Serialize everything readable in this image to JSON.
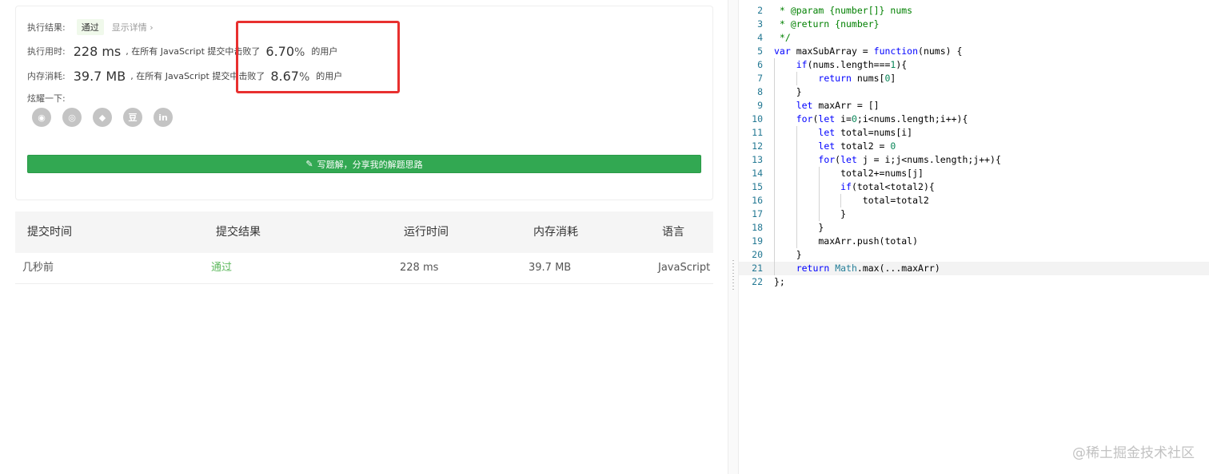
{
  "result": {
    "status_label": "执行结果:",
    "status_value": "通过",
    "detail_link": "显示详情 ›",
    "runtime_label": "执行用时:",
    "runtime_value": "228 ms",
    "runtime_desc": ", 在所有 JavaScript 提交中击败了",
    "runtime_pct": "6.70",
    "runtime_suffix": "的用户",
    "memory_label": "内存消耗:",
    "memory_value": "39.7 MB",
    "memory_desc": ", 在所有 JavaScript 提交中击败了",
    "memory_pct": "8.67",
    "memory_suffix": "的用户",
    "pct_symbol": "%",
    "share_label": "炫耀一下:",
    "share_icons": [
      "wechat-icon",
      "weibo-icon",
      "qq-icon",
      "douban-icon",
      "linkedin-icon"
    ],
    "share_glyphs": [
      "◉",
      "◎",
      "◆",
      "豆",
      "in"
    ],
    "write_button": "写题解，分享我的解题思路",
    "accent_color": "#32a852",
    "highlight_color": "#e8302f"
  },
  "submissions": {
    "headers": [
      "提交时间",
      "提交结果",
      "运行时间",
      "内存消耗",
      "语言"
    ],
    "rows": [
      {
        "time": "几秒前",
        "status": "通过",
        "runtime": "228 ms",
        "memory": "39.7 MB",
        "language": "JavaScript"
      }
    ]
  },
  "editor": {
    "active_line": 21,
    "lines": [
      {
        "n": "2",
        "text": " * @param {number[]} nums"
      },
      {
        "n": "3",
        "text": " * @return {number}"
      },
      {
        "n": "4",
        "text": " */"
      },
      {
        "n": "5",
        "text": "var maxSubArray = function(nums) {"
      },
      {
        "n": "6",
        "text": "    if(nums.length===1){"
      },
      {
        "n": "7",
        "text": "        return nums[0]"
      },
      {
        "n": "8",
        "text": "    }"
      },
      {
        "n": "9",
        "text": "    let maxArr = []"
      },
      {
        "n": "10",
        "text": "    for(let i=0;i<nums.length;i++){"
      },
      {
        "n": "11",
        "text": "        let total=nums[i]"
      },
      {
        "n": "12",
        "text": "        let total2 = 0"
      },
      {
        "n": "13",
        "text": "        for(let j = i;j<nums.length;j++){"
      },
      {
        "n": "14",
        "text": "            total2+=nums[j]"
      },
      {
        "n": "15",
        "text": "            if(total<total2){"
      },
      {
        "n": "16",
        "text": "                total=total2"
      },
      {
        "n": "17",
        "text": "            }"
      },
      {
        "n": "18",
        "text": "        }"
      },
      {
        "n": "19",
        "text": "        maxArr.push(total)"
      },
      {
        "n": "20",
        "text": "    }"
      },
      {
        "n": "21",
        "text": "    return Math.max(...maxArr)"
      },
      {
        "n": "22",
        "text": "};"
      }
    ]
  },
  "watermark": "@稀土掘金技术社区"
}
